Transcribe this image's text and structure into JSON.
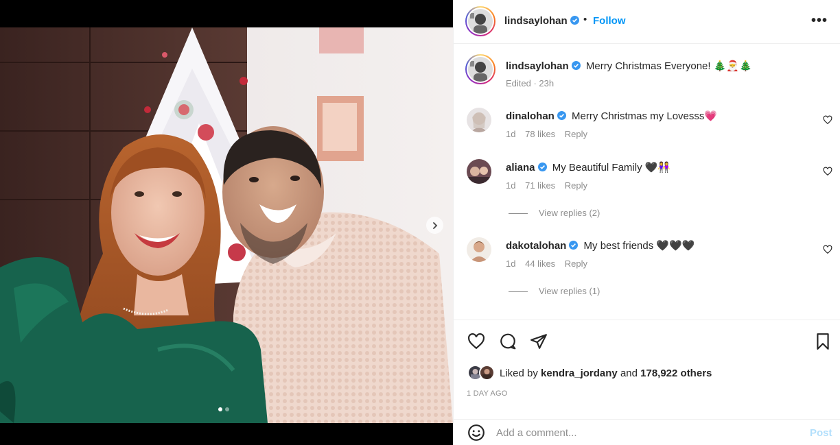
{
  "post": {
    "username": "lindsaylohan",
    "follow_label": "Follow",
    "dot": "•",
    "more_label": "•••",
    "next_icon": "chevron-right-icon",
    "carousel": {
      "count": 2,
      "active_index": 0
    }
  },
  "caption": {
    "username": "lindsaylohan",
    "text": "Merry Christmas Everyone! 🎄🎅🎄",
    "edited": "Edited · 23h"
  },
  "comments": [
    {
      "username": "dinalohan",
      "verified": true,
      "text": "Merry Christmas my Lovesss💗",
      "age": "1d",
      "likes": "78 likes",
      "reply": "Reply"
    },
    {
      "username": "aliana",
      "verified": true,
      "text": "My Beautiful Family 🖤👭",
      "age": "1d",
      "likes": "71 likes",
      "reply": "Reply",
      "view_replies": "View replies (2)"
    },
    {
      "username": "dakotalohan",
      "verified": true,
      "text": "My best friends 🖤🖤🖤",
      "age": "1d",
      "likes": "44 likes",
      "reply": "Reply",
      "view_replies": "View replies (1)"
    }
  ],
  "likes": {
    "prefix": "Liked by",
    "user": "kendra_jordany",
    "joiner": "and",
    "others": "178,922 others"
  },
  "time_ago": "1 DAY AGO",
  "comment_box": {
    "placeholder": "Add a comment...",
    "post_label": "Post"
  },
  "colors": {
    "link_blue": "#0095f6",
    "post_disabled": "#b2dffc",
    "muted": "#8e8e8e",
    "verified_blue": "#3897f0"
  },
  "icons": [
    "heart-icon",
    "comment-icon",
    "share-icon",
    "bookmark-icon",
    "emoji-icon",
    "verified-badge-icon"
  ]
}
